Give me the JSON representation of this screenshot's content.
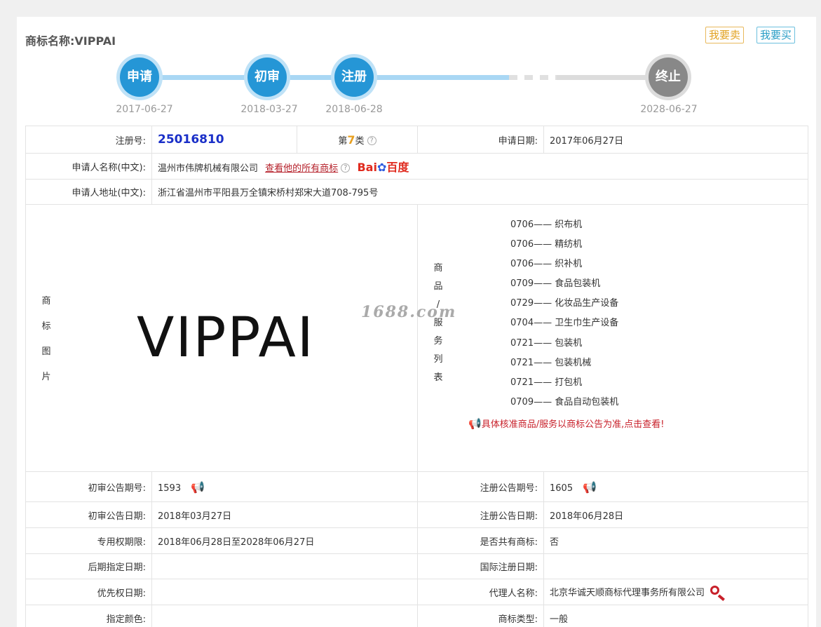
{
  "trademark": {
    "title_label": "商标名称:",
    "name": "VIPPAI"
  },
  "actions": {
    "sell": "我要卖",
    "buy": "我要买"
  },
  "timeline": [
    {
      "label": "申请",
      "date": "2017-06-27"
    },
    {
      "label": "初审",
      "date": "2018-03-27"
    },
    {
      "label": "注册",
      "date": "2018-06-28"
    },
    {
      "label": "终止",
      "date": "2028-06-27"
    }
  ],
  "colors": {
    "accent_blue": "#2596d6",
    "track_blue": "#a9d7f4",
    "gray_step": "#888888",
    "red": "#c8202a"
  },
  "details": {
    "reg_no_label": "注册号:",
    "reg_no": "25016810",
    "class_prefix": "第",
    "class_num": "7",
    "class_suffix": "类",
    "apply_date_label": "申请日期:",
    "apply_date": "2017年06月27日",
    "applicant_label": "申请人名称(中文):",
    "applicant": "温州市伟牌机械有限公司",
    "view_all_link": "查看他的所有商标",
    "baidu_logo_a": "Bai",
    "baidu_logo_b": "百度",
    "address_label": "申请人地址(中文):",
    "address": "浙江省温州市平阳县万全镇宋桥村郑宋大道708-795号",
    "image_label": [
      "商",
      "标",
      "图",
      "片"
    ],
    "goods_label": [
      "商",
      "品",
      "/",
      "服",
      "务",
      "列",
      "表"
    ],
    "goods": [
      "0706—— 织布机",
      "0706—— 精纺机",
      "0706—— 织补机",
      "0709—— 食品包装机",
      "0729—— 化妆品生产设备",
      "0704—— 卫生巾生产设备",
      "0721—— 包装机",
      "0721—— 包装机械",
      "0721—— 打包机",
      "0709—— 食品自动包装机"
    ],
    "goods_notice": "具体核准商品/服务以商标公告为准,点击查看!",
    "watermark": "1688.com",
    "prelim_no_label": "初审公告期号:",
    "prelim_no": "1593",
    "reg_pub_no_label": "注册公告期号:",
    "reg_pub_no": "1605",
    "prelim_date_label": "初审公告日期:",
    "prelim_date": "2018年03月27日",
    "reg_pub_date_label": "注册公告日期:",
    "reg_pub_date": "2018年06月28日",
    "exclusive_label": "专用权期限:",
    "exclusive": "2018年06月28日至2028年06月27日",
    "shared_label": "是否共有商标:",
    "shared": "否",
    "later_label": "后期指定日期:",
    "later": "",
    "intl_label": "国际注册日期:",
    "intl": "",
    "priority_label": "优先权日期:",
    "priority": "",
    "agent_label": "代理人名称:",
    "agent": "北京华诚天顺商标代理事务所有限公司",
    "color_label": "指定颜色:",
    "color": "",
    "type_label": "商标类型:",
    "type": "一般"
  }
}
